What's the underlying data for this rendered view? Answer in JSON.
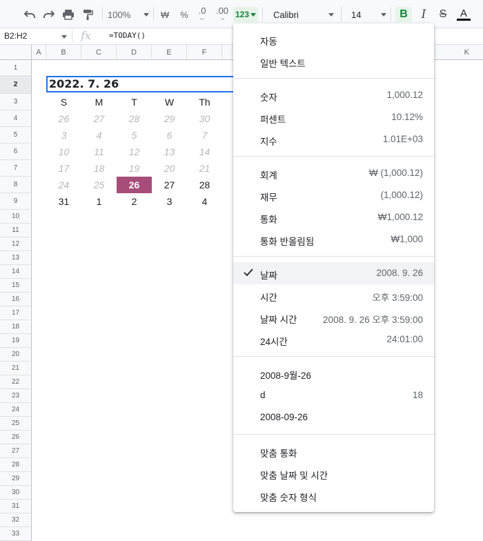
{
  "toolbar": {
    "zoom": "100%",
    "currency_symbol": "₩",
    "percent_symbol": "%",
    "decimal_decrease": ".0",
    "decimal_increase": ".00",
    "format_number": "123",
    "font": "Calibri",
    "font_size": "14",
    "bold": "B",
    "italic": "I",
    "strike": "S",
    "text_color": "A"
  },
  "formula_bar": {
    "name_box": "B2:H2",
    "fx": "fx",
    "formula": "=TODAY()"
  },
  "columns": [
    "A",
    "B",
    "C",
    "D",
    "E",
    "F",
    "K"
  ],
  "rows": [
    "1",
    "2",
    "3",
    "4",
    "5",
    "6",
    "7",
    "8",
    "9",
    "10",
    "11",
    "12",
    "13",
    "14",
    "15",
    "16",
    "17",
    "18",
    "19",
    "20",
    "21",
    "22",
    "23",
    "24",
    "25",
    "26",
    "27",
    "28",
    "29",
    "30",
    "31",
    "32",
    "33"
  ],
  "sheet": {
    "title_cell": "2022. 7. 26",
    "weekday_headers": [
      "S",
      "M",
      "T",
      "W",
      "Th"
    ],
    "calendar": [
      [
        "26",
        "27",
        "28",
        "29",
        "30"
      ],
      [
        "3",
        "4",
        "5",
        "6",
        "7"
      ],
      [
        "10",
        "11",
        "12",
        "13",
        "14"
      ],
      [
        "17",
        "18",
        "19",
        "20",
        "21"
      ],
      [
        "24",
        "25",
        "26",
        "27",
        "28"
      ],
      [
        "31",
        "1",
        "2",
        "3",
        "4"
      ]
    ],
    "today_color": "#a64d79"
  },
  "menu": {
    "groups": [
      [
        {
          "label": "자동",
          "value": ""
        },
        {
          "label": "일반 텍스트",
          "value": ""
        }
      ],
      [
        {
          "label": "숫자",
          "value": "1,000.12"
        },
        {
          "label": "퍼센트",
          "value": "10.12%"
        },
        {
          "label": "지수",
          "value": "1.01E+03"
        }
      ],
      [
        {
          "label": "회계",
          "value": "₩ (1,000.12)"
        },
        {
          "label": "재무",
          "value": "(1,000.12)"
        },
        {
          "label": "통화",
          "value": "₩1,000.12"
        },
        {
          "label": "통화 반올림됨",
          "value": "₩1,000"
        }
      ],
      [
        {
          "label": "날짜",
          "value": "2008. 9. 26",
          "checked": true
        },
        {
          "label": "시간",
          "value": "오후 3:59:00"
        },
        {
          "label": "날짜 시간",
          "value": "2008. 9. 26 오후 3:59:00"
        },
        {
          "label": "24시간",
          "value": "24:01:00"
        }
      ],
      [
        {
          "label": "2008-9월-26",
          "value": ""
        },
        {
          "label": "d",
          "value": "18"
        },
        {
          "label": "2008-09-26",
          "value": ""
        }
      ],
      [
        {
          "label": "맞춤 통화",
          "value": ""
        },
        {
          "label": "맞춤 날짜 및 시간",
          "value": ""
        },
        {
          "label": "맞춤 숫자 형식",
          "value": ""
        }
      ]
    ]
  }
}
